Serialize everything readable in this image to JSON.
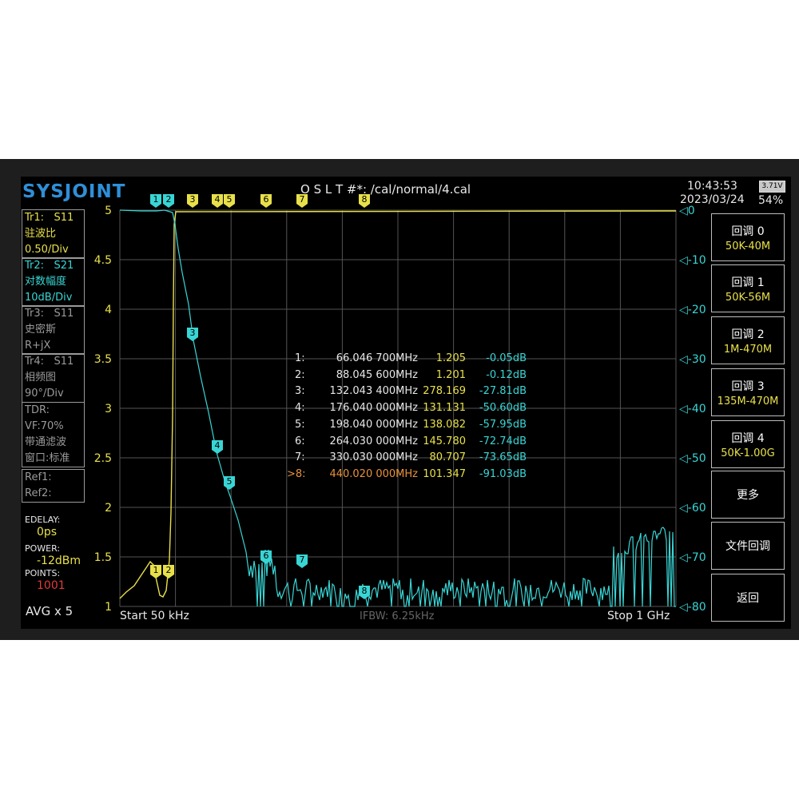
{
  "header": {
    "logo": "SYSJOINT",
    "cal_path": "O S L T #*:    /cal/normal/4.cal",
    "time": "10:43:53",
    "date": "2023/03/24",
    "battery_voltage": "3.71V",
    "battery_percent": "54%"
  },
  "traces": [
    {
      "id": "Tr1:",
      "param": "S11",
      "format": "驻波比",
      "scale": "0.50/Div",
      "color": "#e8e04a"
    },
    {
      "id": "Tr2:",
      "param": "S21",
      "format": "对数幅度",
      "scale": "10dB/Div",
      "color": "#39d5d5"
    },
    {
      "id": "Tr3:",
      "param": "S11",
      "format": "史密斯",
      "scale": "R+jX",
      "color": "#9a9a9a"
    },
    {
      "id": "Tr4:",
      "param": "S11",
      "format": "相频图",
      "scale": "90°/Div",
      "color": "#9a9a9a"
    }
  ],
  "tdr": {
    "line1": "TDR:",
    "line2": "VF:70%",
    "line3": "带通滤波",
    "line4": "窗口:标准"
  },
  "refs": {
    "ref1": "Ref1:",
    "ref2": "Ref2:"
  },
  "status": {
    "edelay_label": "EDELAY:",
    "edelay_value": "0ps",
    "power_label": "POWER:",
    "power_value": "-12dBm",
    "points_label": "POINTS:",
    "points_value": "1001",
    "avg": "AVG x 5"
  },
  "axis": {
    "left_ticks": [
      "5",
      "4.5",
      "4",
      "3.5",
      "3",
      "2.5",
      "2",
      "1.5",
      "1"
    ],
    "right_ticks": [
      "0",
      "-10",
      "-20",
      "-30",
      "-40",
      "-50",
      "-60",
      "-70",
      "-80"
    ]
  },
  "footer": {
    "start": "Start   50 kHz",
    "ifbw": "IFBW: 6.25kHz",
    "stop": "Stop   1 GHz"
  },
  "markers": [
    {
      "label": "1:",
      "freq": "66.046 700MHz",
      "swr": "1.205",
      "s21": "-0.05dB",
      "active": false
    },
    {
      "label": "2:",
      "freq": "88.045 600MHz",
      "swr": "1.201",
      "s21": "-0.12dB",
      "active": false
    },
    {
      "label": "3:",
      "freq": "132.043 400MHz",
      "swr": "278.169",
      "s21": "-27.81dB",
      "active": false
    },
    {
      "label": "4:",
      "freq": "176.040 000MHz",
      "swr": "131.131",
      "s21": "-50.60dB",
      "active": false
    },
    {
      "label": "5:",
      "freq": "198.040 000MHz",
      "swr": "138.082",
      "s21": "-57.95dB",
      "active": false
    },
    {
      "label": "6:",
      "freq": "264.030 000MHz",
      "swr": "145.780",
      "s21": "-72.74dB",
      "active": false
    },
    {
      "label": "7:",
      "freq": "330.030 000MHz",
      "swr": "80.707",
      "s21": "-73.65dB",
      "active": false
    },
    {
      "label": ">8:",
      "freq": "440.020 000MHz",
      "swr": "101.347",
      "s21": "-91.03dB",
      "active": true
    }
  ],
  "softkeys": [
    {
      "title": "回调 0",
      "sub": "50K-40M"
    },
    {
      "title": "回调 1",
      "sub": "50K-56M"
    },
    {
      "title": "回调 2",
      "sub": "1M-470M"
    },
    {
      "title": "回调 3",
      "sub": "135M-470M"
    },
    {
      "title": "回调 4",
      "sub": "50K-1.00G"
    },
    {
      "title": "更多",
      "sub": ""
    },
    {
      "title": "文件回调",
      "sub": ""
    },
    {
      "title": "返回",
      "sub": ""
    }
  ],
  "marker_tags": [
    "1",
    "2",
    "3",
    "4",
    "5",
    "6",
    "7",
    "8"
  ],
  "colors": {
    "swr_trace": "#e8e04a",
    "s21_trace": "#39d5d5",
    "active_marker": "#e8923a",
    "grid": "#555555",
    "logo": "#2f8fd8"
  }
}
